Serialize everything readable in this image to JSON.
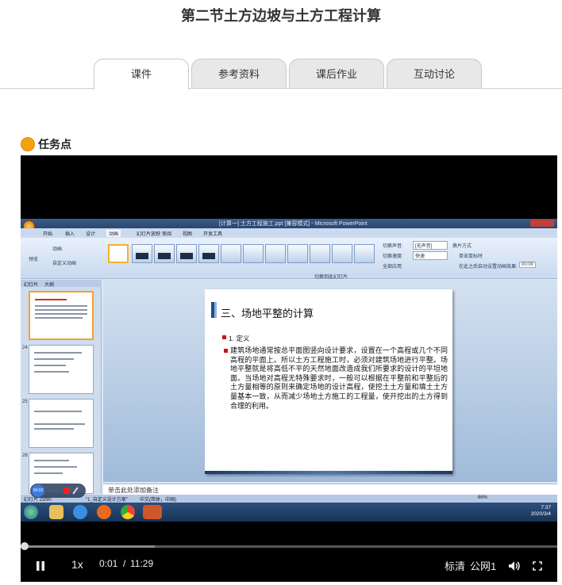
{
  "page": {
    "title": "第二节土方边坡与土方工程计算"
  },
  "tabs": [
    {
      "label": "课件",
      "active": true
    },
    {
      "label": "参考资料",
      "active": false
    },
    {
      "label": "课后作业",
      "active": false
    },
    {
      "label": "互动讨论",
      "active": false
    }
  ],
  "task": {
    "label": "任务点"
  },
  "screen": {
    "window_title": "[计算一] 土方工程施工.ppt [兼容模式] - Microsoft PowerPoint",
    "menu": [
      "开始",
      "插入",
      "设计",
      "动画",
      "幻灯片放映",
      "审阅",
      "视图",
      "开发工具"
    ],
    "ribbon": {
      "preview": "预览",
      "animation": "动画",
      "custom_animation": "自定义动画",
      "sound_label": "切换声音:",
      "sound_value": "[无声音]",
      "speed_label": "切换速度:",
      "speed_value": "快速",
      "apply_all": "全部应用",
      "switch_mode": "换片方式",
      "on_click": "单击鼠标时",
      "auto_after": "在此之后自动设置动画效果:",
      "auto_time": "00:00",
      "group_label": "切换到此幻灯片"
    },
    "sidebar_tabs": [
      "幻灯片",
      "大纲"
    ],
    "thumb_numbers": [
      "",
      "24",
      "25",
      "26"
    ],
    "slide": {
      "title": "三、场地平整的计算",
      "def": "1. 定义",
      "body": "建筑场地通常按总平面图竖向设计要求，设置在一个高程或几个不同高程的平面上。所以土方工程施工时，必须对建筑场地进行平整。场地平整就是将高低不平的天然地面改造成我们所要求的设计的平坦地面。当场地对高程无特殊要求时，一般可以根据在平整前和平整后的土方量相等的原则来确定场地的设计高程，使挖土土方量和填土土方量基本一致，从而减少场地土方施工的工程量，使开挖出的土方得到合理的利用。"
    },
    "notes_placeholder": "单击此处添加备注",
    "status": {
      "slide": "幻灯片 23/90",
      "theme": "\"1_自定义设计方案\"",
      "lang": "中文(简体，中国)",
      "zoom": "66%"
    },
    "recorder_time": "00:02",
    "clock_time": "7:37",
    "clock_date": "2020/3/4"
  },
  "player": {
    "speed": "1x",
    "current_time": "0:01",
    "separator": "/",
    "duration": "11:29",
    "quality": "标清",
    "line": "公网1",
    "progress_fraction": 0.0015,
    "buffered_fraction": 0.25
  },
  "colors": {
    "task_dot": "#f3a20f",
    "player_bg": "#000000",
    "accent_red": "#d01010"
  }
}
